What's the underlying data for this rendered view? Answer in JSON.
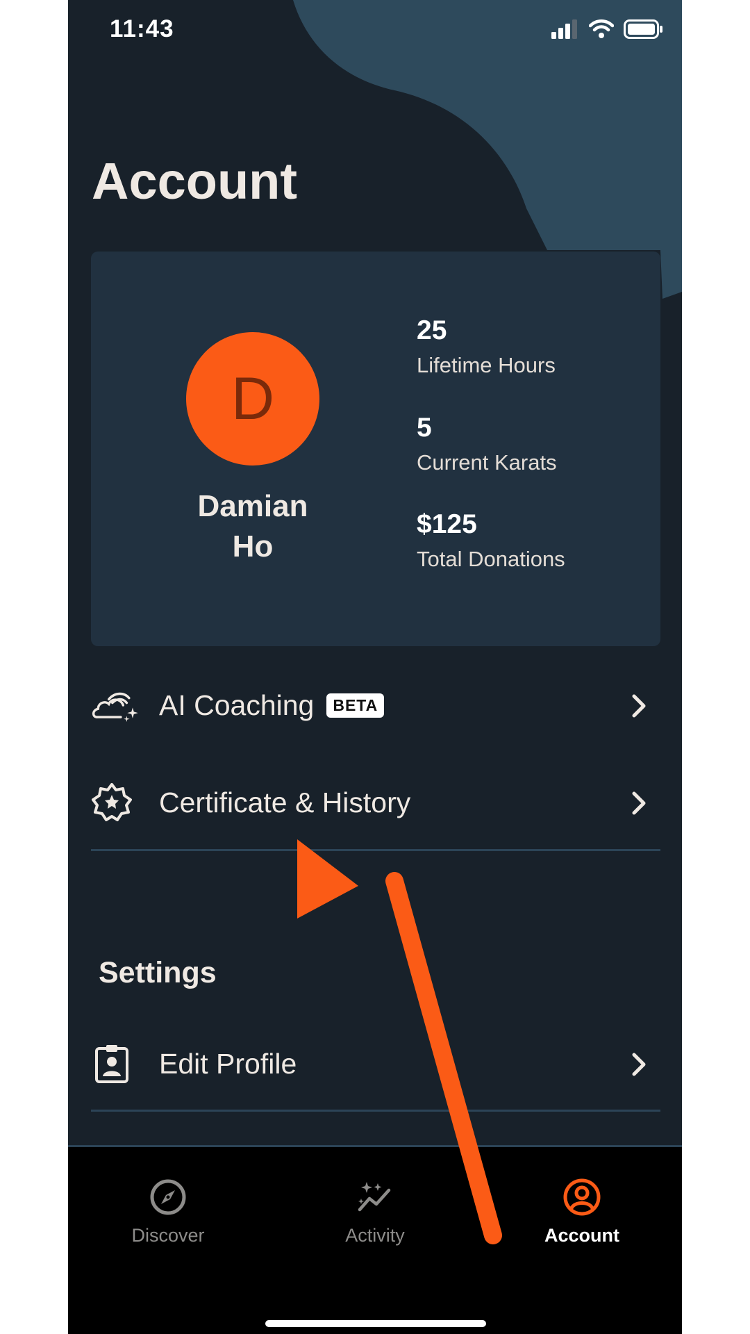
{
  "status_bar": {
    "time": "11:43"
  },
  "page": {
    "title": "Account"
  },
  "profile": {
    "avatar_initial": "D",
    "first_name": "Damian",
    "last_name": "Ho",
    "stats": [
      {
        "value": "25",
        "label": "Lifetime Hours"
      },
      {
        "value": "5",
        "label": "Current Karats"
      },
      {
        "value": "$125",
        "label": "Total Donations"
      }
    ]
  },
  "menu": {
    "ai_coaching": {
      "label": "AI Coaching",
      "badge": "BETA",
      "icon": "cloud-sparkle-icon"
    },
    "certificate": {
      "label": "Certificate & History",
      "icon": "badge-star-icon"
    }
  },
  "settings": {
    "title": "Settings",
    "edit_profile": {
      "label": "Edit Profile",
      "icon": "id-badge-icon"
    }
  },
  "tabbar": {
    "tabs": [
      {
        "label": "Discover",
        "icon": "compass-icon",
        "active": false
      },
      {
        "label": "Activity",
        "icon": "sparkle-chart-icon",
        "active": false
      },
      {
        "label": "Account",
        "icon": "user-circle-icon",
        "active": true
      }
    ]
  },
  "colors": {
    "background": "#18212a",
    "card": "#213140",
    "accent": "#fb5b16",
    "blob": "#2e4a5c",
    "divider": "#2c4457"
  }
}
